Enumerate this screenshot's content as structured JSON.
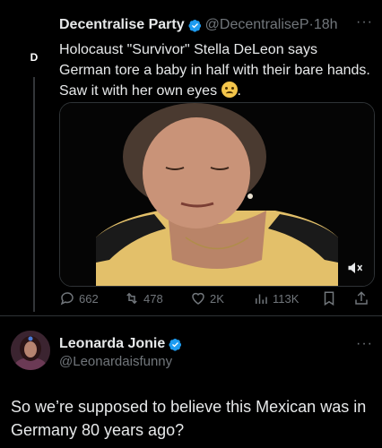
{
  "tweet": {
    "avatar_letter": "D",
    "author_name": "Decentralise Party",
    "handle": "@DecentraliseP",
    "separator": "·",
    "time": "18h",
    "more": "···",
    "text": "Holocaust \"Survivor\" Stella DeLeon says German tore a baby in half with their bare hands. Saw it with her own eyes",
    "text_end": ".",
    "emoji": "grimacing-face",
    "actions": {
      "replies": "662",
      "retweets": "478",
      "likes": "2K",
      "views": "113K"
    }
  },
  "reply": {
    "author_name": "Leonarda Jonie",
    "handle": "@Leonardaisfunny",
    "more": "···",
    "text": "So we’re supposed to believe this Mexican was in Germany 80 years ago?"
  },
  "colors": {
    "background": "#000000",
    "text": "#e7e9ea",
    "muted": "#71767b",
    "verified": "#1d9bf0"
  }
}
